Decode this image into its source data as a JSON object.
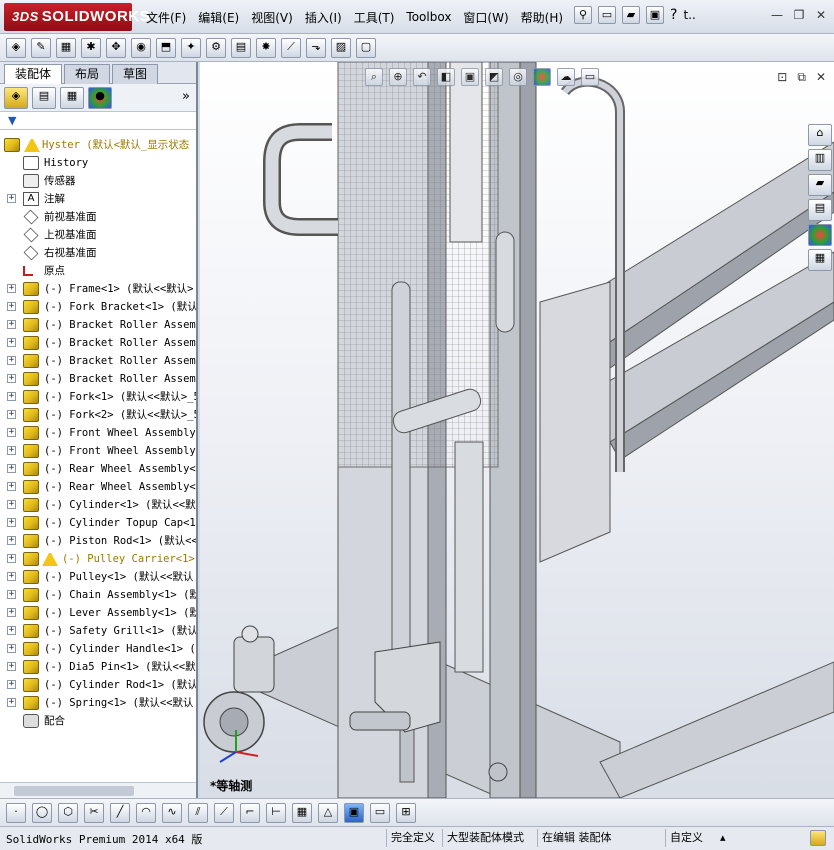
{
  "app": {
    "logo_prefix": "3DS",
    "logo_text": "SOLIDWORKS"
  },
  "menu": [
    "文件(F)",
    "编辑(E)",
    "视图(V)",
    "插入(I)",
    "工具(T)",
    "Toolbox",
    "窗口(W)",
    "帮助(H)"
  ],
  "title_tools": {
    "pin_icon": "pushpin-icon",
    "new_icon": "new-document-icon",
    "open_icon": "open-folder-icon",
    "save_icon": "save-icon",
    "help_icon": "?",
    "user_icon": "t..",
    "window_controls": [
      "—",
      "❐",
      "✕"
    ]
  },
  "left_panel": {
    "tabs": [
      "装配体",
      "布局",
      "草图"
    ],
    "active_tab": 0,
    "panel_icons": [
      "featuremanager-icon",
      "propertymanager-icon",
      "configurationmanager-icon",
      "displaymanager-icon"
    ],
    "more": "»",
    "filter": "▼"
  },
  "tree": {
    "root": "Hyster  (默认<默认_显示状态",
    "items": [
      {
        "label": "History",
        "icon": "history-icon",
        "expand": false
      },
      {
        "label": "传感器",
        "icon": "sensor-icon",
        "expand": false
      },
      {
        "label": "注解",
        "icon": "annotation-icon",
        "expand": true
      },
      {
        "label": "前视基准面",
        "icon": "plane-icon",
        "expand": false
      },
      {
        "label": "上视基准面",
        "icon": "plane-icon",
        "expand": false
      },
      {
        "label": "右视基准面",
        "icon": "plane-icon",
        "expand": false
      },
      {
        "label": "原点",
        "icon": "origin-icon",
        "expand": false
      },
      {
        "label": "(-) Frame<1> (默认<<默认>",
        "icon": "part-icon",
        "expand": true
      },
      {
        "label": "(-) Fork Bracket<1> (默认<",
        "icon": "part-icon",
        "expand": true
      },
      {
        "label": "(-) Bracket Roller Assembl",
        "icon": "part-icon",
        "expand": true
      },
      {
        "label": "(-) Bracket Roller Assembl",
        "icon": "part-icon",
        "expand": true
      },
      {
        "label": "(-) Bracket Roller Assembl",
        "icon": "part-icon",
        "expand": true
      },
      {
        "label": "(-) Bracket Roller Assembl",
        "icon": "part-icon",
        "expand": true
      },
      {
        "label": "(-) Fork<1> (默认<<默认>_5",
        "icon": "part-icon",
        "expand": true
      },
      {
        "label": "(-) Fork<2> (默认<<默认>_5",
        "icon": "part-icon",
        "expand": true
      },
      {
        "label": "(-) Front Wheel Assembly<",
        "icon": "part-icon",
        "expand": true
      },
      {
        "label": "(-) Front Wheel Assembly<",
        "icon": "part-icon",
        "expand": true
      },
      {
        "label": "(-) Rear Wheel Assembly<1",
        "icon": "part-icon",
        "expand": true
      },
      {
        "label": "(-) Rear Wheel Assembly<2",
        "icon": "part-icon",
        "expand": true
      },
      {
        "label": "(-) Cylinder<1> (默认<<默",
        "icon": "part-icon",
        "expand": true
      },
      {
        "label": "(-) Cylinder Topup Cap<1>",
        "icon": "part-icon",
        "expand": true
      },
      {
        "label": "(-) Piston Rod<1> (默认<<",
        "icon": "part-icon",
        "expand": true
      },
      {
        "label": "(-) Pulley Carrier<1>",
        "icon": "warning-part-icon",
        "expand": true,
        "warn": true
      },
      {
        "label": "(-) Pulley<1> (默认<<默认",
        "icon": "part-icon",
        "expand": true
      },
      {
        "label": "(-) Chain Assembly<1> (默",
        "icon": "part-icon",
        "expand": true
      },
      {
        "label": "(-) Lever Assembly<1> (默",
        "icon": "part-icon",
        "expand": true
      },
      {
        "label": "(-) Safety Grill<1> (默认",
        "icon": "part-icon",
        "expand": true
      },
      {
        "label": "(-) Cylinder Handle<1> (默",
        "icon": "part-icon",
        "expand": true
      },
      {
        "label": "(-) Dia5 Pin<1> (默认<<默",
        "icon": "part-icon",
        "expand": true
      },
      {
        "label": "(-) Cylinder Rod<1> (默认",
        "icon": "part-icon",
        "expand": true
      },
      {
        "label": "(-) Spring<1> (默认<<默认",
        "icon": "part-icon",
        "expand": true
      },
      {
        "label": "配合",
        "icon": "mates-icon",
        "expand": false
      }
    ]
  },
  "viewport": {
    "view_label": "*等轴测",
    "heads_up_icons": [
      "zoom-to-fit-icon",
      "zoom-area-icon",
      "previous-view-icon",
      "section-view-icon",
      "view-orientation-icon",
      "display-style-icon",
      "hide-show-icon",
      "edit-appearance-icon",
      "apply-scene-icon",
      "view-settings-icon"
    ],
    "task_pane_icons": [
      "home-icon",
      "design-library-icon",
      "file-explorer-icon",
      "view-palette-icon",
      "appearances-icon",
      "custom-properties-icon"
    ],
    "window_controls": [
      "⊡",
      "⧉",
      "✕"
    ]
  },
  "statusbar": {
    "version": "SolidWorks Premium 2014 x64 版",
    "fully_defined": "完全定义",
    "large_assembly": "大型装配体模式",
    "editing": "在编辑 装配体",
    "custom": "自定义",
    "custom_arrow": "▴"
  }
}
